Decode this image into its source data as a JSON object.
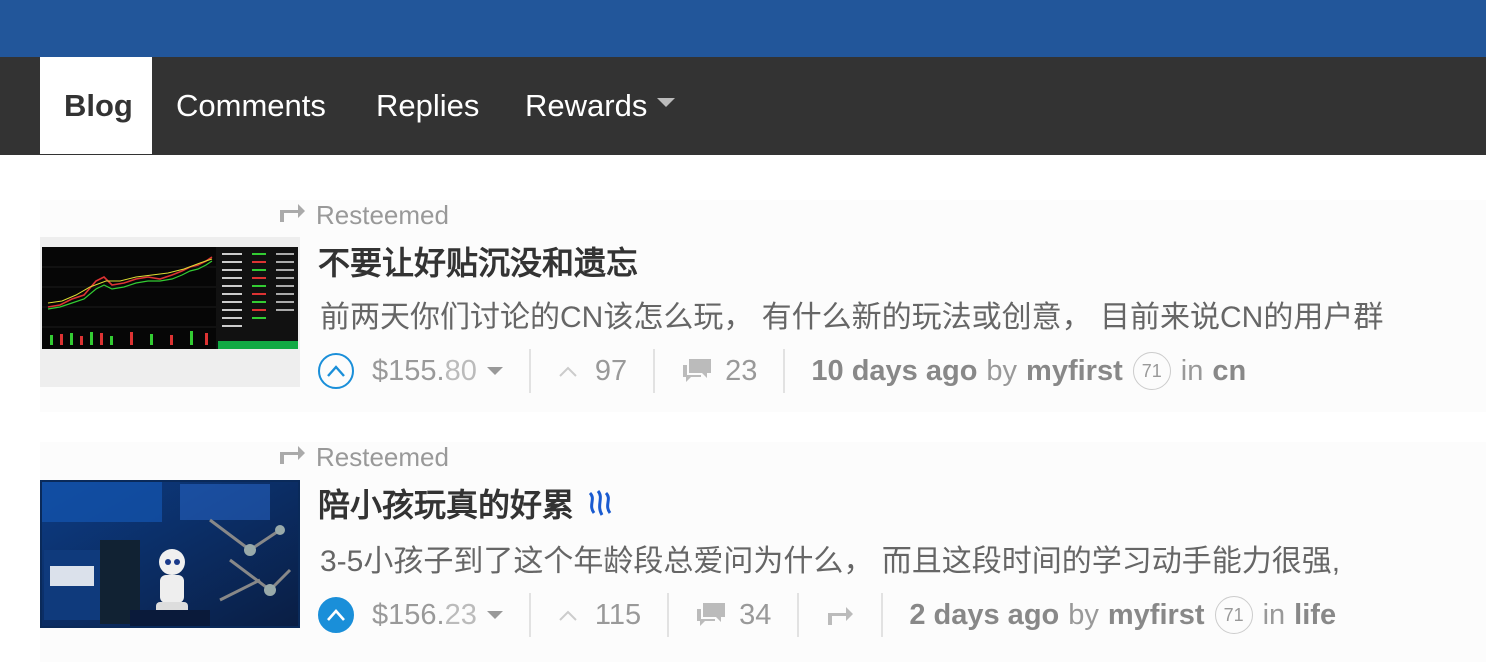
{
  "tabs": {
    "blog": "Blog",
    "comments": "Comments",
    "replies": "Replies",
    "rewards": "Rewards"
  },
  "posts": [
    {
      "reblog_label": "Resteemed",
      "title": "不要让好贴沉没和遗忘",
      "summary": "前两天你们讨论的CN该怎么玩， 有什么新的玩法或创意， 目前来说CN的用户群",
      "payout_dollars": "$155.",
      "payout_cents": "80",
      "votes": "97",
      "comments": "23",
      "time": "10 days ago",
      "by": "by",
      "author": "myfirst",
      "reputation": "71",
      "in": "in",
      "category": "cn"
    },
    {
      "reblog_label": "Resteemed",
      "title": "陪小孩玩真的好累",
      "summary": "3-5小孩子到了这个年龄段总爱问为什么， 而且这段时间的学习动手能力很强,",
      "payout_dollars": "$156.",
      "payout_cents": "23",
      "votes": "115",
      "comments": "34",
      "time": "2 days ago",
      "by": "by",
      "author": "myfirst",
      "reputation": "71",
      "in": "in",
      "category": "life"
    }
  ],
  "colors": {
    "header_blue": "#22569a",
    "tabbar": "#333333",
    "vote_blue": "#1a8fd9"
  }
}
